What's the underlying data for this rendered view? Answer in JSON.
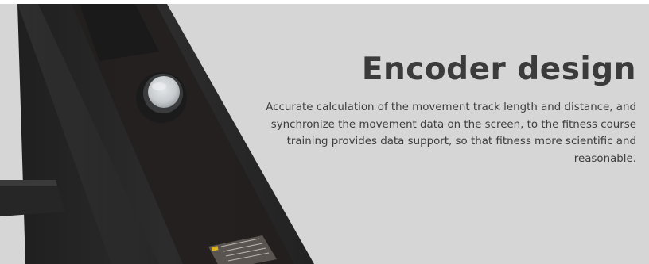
{
  "heading": {
    "title": "Encoder design",
    "description": "Accurate calculation of the movement track length and distance, and synchronize the movement data on the screen, to the fitness course training provides data support, so that fitness more scientific and reasonable."
  },
  "colors": {
    "background": "#d6d6d6",
    "title_text": "#3b3b3b",
    "body_text": "#3d3d3d",
    "product_body": "#2a2a2a",
    "encoder_cap": "#c9cdd0"
  },
  "icons": {
    "encoder": "encoder-button-icon",
    "warning_label": "warning-sticker-icon"
  }
}
